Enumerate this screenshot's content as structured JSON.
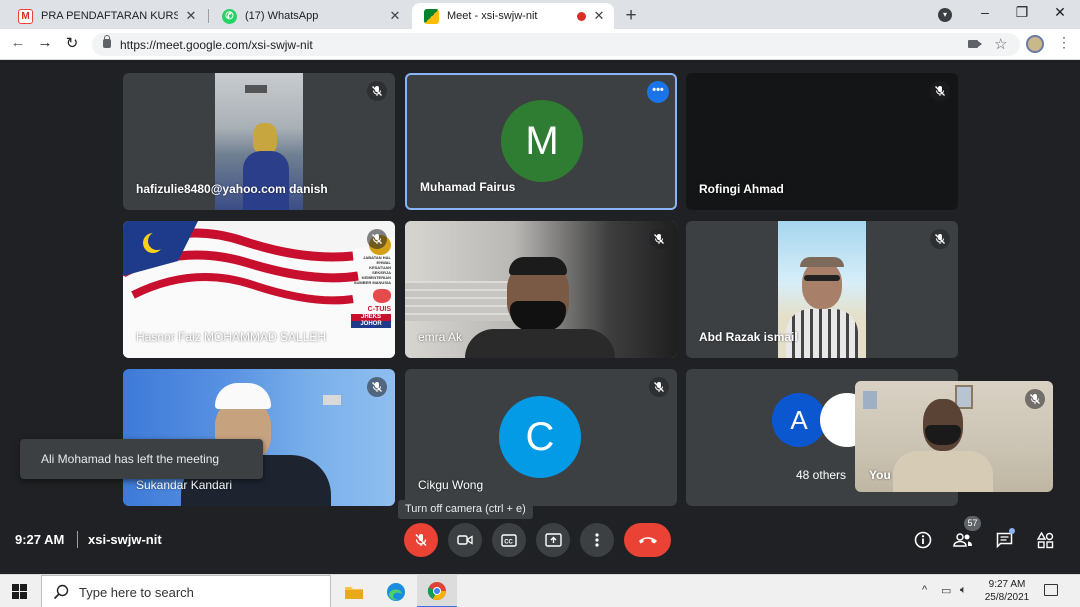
{
  "browser": {
    "tabs": [
      {
        "title": "PRA PENDAFTARAN KURSUS PEI",
        "favicon": "gmail-icon",
        "active": false
      },
      {
        "title": "(17) WhatsApp",
        "favicon": "whatsapp-icon",
        "active": false
      },
      {
        "title": "Meet - xsi-swjw-nit",
        "favicon": "meet-icon",
        "active": true
      }
    ],
    "new_tab": "+",
    "url": "https://meet.google.com/xsi-swjw-nit"
  },
  "meet": {
    "tiles": [
      {
        "name": "hafizulie8480@yahoo.com danish",
        "type": "video",
        "muted": true
      },
      {
        "name": "Muhamad Fairus",
        "type": "avatar",
        "initial": "M",
        "avatar_color": "#2e7d32",
        "muted": false,
        "speaking": true
      },
      {
        "name": "Rofingi Ahmad",
        "type": "dark",
        "muted": true
      },
      {
        "name": "Hasnor Faiz MOHAMMAD SALLEH",
        "type": "flag",
        "muted": true
      },
      {
        "name": "emra Ak",
        "type": "video",
        "muted": true
      },
      {
        "name": "Abd Razak ismail",
        "type": "video",
        "muted": true
      },
      {
        "name": "Sukandar Kandari",
        "type": "video",
        "muted": true
      },
      {
        "name": "Cikgu Wong",
        "type": "avatar",
        "initial": "C",
        "avatar_color": "#039be5",
        "muted": true
      },
      {
        "name": "48 others",
        "type": "others",
        "initial": "A",
        "avatar_color": "#0b57d0"
      }
    ],
    "self_tile": {
      "name": "You",
      "muted": true
    },
    "flag_logo_text": [
      "JABATAN HAL EHWAL",
      "KESATUAN SEKERJA",
      "KEMENTERIAN SUMBER MANUSIA",
      "C-TUIS",
      "JHEKS",
      "JOHOR"
    ],
    "toast": "Ali Mohamad has left the meeting",
    "tooltip": "Turn off camera (ctrl + e)",
    "time": "9:27 AM",
    "meeting_code": "xsi-swjw-nit",
    "participant_count": "57",
    "colors": {
      "hangup": "#ea4335",
      "speaking_border": "#8ab4f8",
      "tile_bg": "#3c4043"
    }
  },
  "taskbar": {
    "search_placeholder": "Type here to search",
    "time": "9:27 AM",
    "date": "25/8/2021",
    "pinned": [
      "file-explorer-icon",
      "edge-icon",
      "chrome-icon"
    ]
  }
}
